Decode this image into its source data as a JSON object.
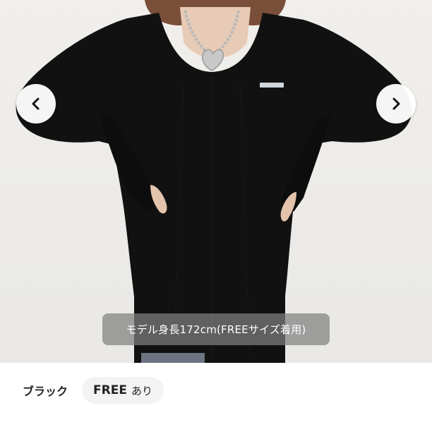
{
  "product_image": {
    "caption": "モデル身長172cm(FREEサイズ着用)",
    "prev_icon": "chevron-left-icon",
    "next_icon": "chevron-right-icon"
  },
  "variant": {
    "color": "ブラック",
    "size": "FREE",
    "stock": "あり"
  },
  "colors": {
    "garment": "#111111",
    "background": "#eceae7",
    "caption_bg": "#808080",
    "chip_bg": "#f3f3f3"
  }
}
